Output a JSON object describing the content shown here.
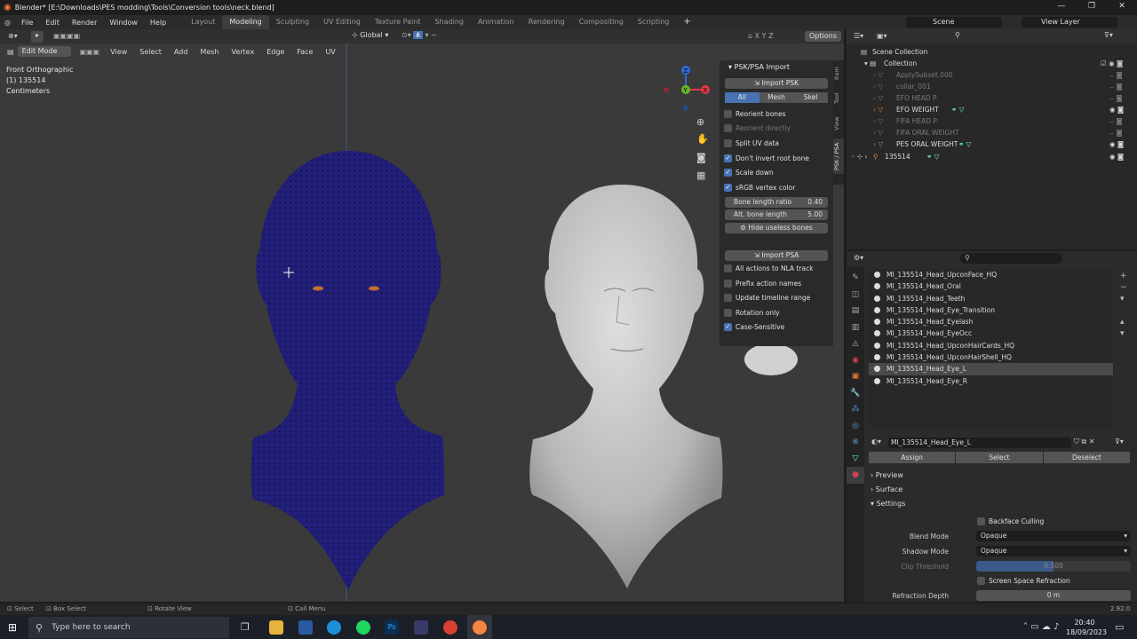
{
  "window": {
    "title": "Blender* [E:\\Downloads\\PES modding\\Tools\\Conversion tools\\neck.blend]",
    "controls": [
      "—",
      "❐",
      "✕"
    ]
  },
  "topbar": {
    "menus": [
      "File",
      "Edit",
      "Render",
      "Window",
      "Help"
    ],
    "workspaces": [
      "Layout",
      "Modeling",
      "Sculpting",
      "UV Editing",
      "Texture Paint",
      "Shading",
      "Animation",
      "Rendering",
      "Compositing",
      "Scripting"
    ],
    "active_workspace": "Modeling",
    "add_tab": "+",
    "scene": "Scene",
    "view_layer": "View Layer"
  },
  "viewport": {
    "orientation": "Global",
    "options": "Options",
    "mode": "Edit Mode",
    "menus": [
      "View",
      "Select",
      "Add",
      "Mesh",
      "Vertex",
      "Edge",
      "Face",
      "UV"
    ],
    "overlay_lines": [
      "Front Orthographic",
      "(1) 135514",
      "Centimeters"
    ],
    "gizmo": {
      "z": "Z",
      "y": "Y",
      "x": "X"
    }
  },
  "npanel": {
    "title": "PSK/PSA Import",
    "import_psk": "Import PSK",
    "segments": [
      "All",
      "Mesh",
      "Skel"
    ],
    "active_segment": "All",
    "psk_options": [
      {
        "label": "Reorient bones",
        "checked": false,
        "dim": false
      },
      {
        "label": "Reorient directly",
        "checked": false,
        "dim": true
      },
      {
        "label": "Split UV data",
        "checked": false,
        "dim": false
      },
      {
        "label": "Don't invert root bone",
        "checked": true,
        "dim": false
      },
      {
        "label": "Scale down",
        "checked": true,
        "dim": false
      },
      {
        "label": "sRGB vertex color",
        "checked": true,
        "dim": false
      }
    ],
    "bone_length_ratio": {
      "label": "Bone length ratio",
      "value": "0.40"
    },
    "alt_bone_length": {
      "label": "Alt. bone length",
      "value": "5.00"
    },
    "hide_useless": "Hide useless bones",
    "import_psa": "Import PSA",
    "psa_options": [
      {
        "label": "All actions to NLA track",
        "checked": false
      },
      {
        "label": "Prefix action names",
        "checked": false
      },
      {
        "label": "Update timeline range",
        "checked": false
      },
      {
        "label": "Rotation only",
        "checked": false
      },
      {
        "label": "Case-Sensitive",
        "checked": true
      }
    ],
    "tabs": [
      "Item",
      "Tool",
      "View",
      "PSK / PSA"
    ]
  },
  "outliner": {
    "root": "Scene Collection",
    "collection": "Collection",
    "items": [
      {
        "name": "ApplySubset.000",
        "dim": true
      },
      {
        "name": "collar_001",
        "dim": true
      },
      {
        "name": "EFO HEAD P",
        "dim": true
      },
      {
        "name": "EFO WEIGHT",
        "dim": false
      },
      {
        "name": "FIFA HEAD P",
        "dim": true
      },
      {
        "name": "FIFA ORAL WEIGHT",
        "dim": true
      },
      {
        "name": "PES ORAL WEIGHT",
        "dim": false
      }
    ],
    "armature": "135514"
  },
  "materials": {
    "slots": [
      "MI_135514_Head_UpconFace_HQ",
      "MI_135514_Head_Oral",
      "MI_135514_Head_Teeth",
      "MI_135514_Head_Eye_Transition",
      "MI_135514_Head_Eyelash",
      "MI_135514_Head_EyeOcc",
      "MI_135514_Head_UpconHairCards_HQ",
      "MI_135514_Head_UpconHairShell_HQ",
      "MI_135514_Head_Eye_L",
      "MI_135514_Head_Eye_R"
    ],
    "selected_index": 8,
    "active_material": "MI_135514_Head_Eye_L",
    "buttons": [
      "Assign",
      "Select",
      "Deselect"
    ],
    "sections": [
      "Preview",
      "Surface",
      "Settings"
    ],
    "backface_culling": "Backface Culling",
    "blend_mode": {
      "label": "Blend Mode",
      "value": "Opaque"
    },
    "shadow_mode": {
      "label": "Shadow Mode",
      "value": "Opaque"
    },
    "clip_threshold": {
      "label": "Clip Threshold",
      "value": "0.500"
    },
    "screen_space_refraction": "Screen Space Refraction",
    "refraction_depth": {
      "label": "Refraction Depth",
      "value": "0 m"
    }
  },
  "statusbar": {
    "select": "Select",
    "box_select": "Box Select",
    "rotate": "Rotate View",
    "call_menu": "Call Menu",
    "version": "2.92.0"
  },
  "taskbar": {
    "search_placeholder": "Type here to search",
    "time": "20:40",
    "date": "18/09/2023"
  },
  "colors": {
    "accent": "#4772b3",
    "mesh_blue": "#221f7a",
    "head_gray": "#c8c8c8",
    "bg_viewport": "#3a3a3a"
  }
}
